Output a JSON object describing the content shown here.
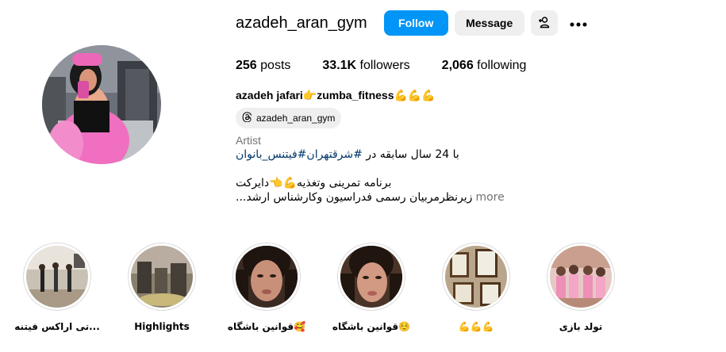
{
  "profile": {
    "username": "azadeh_aran_gym",
    "follow_label": "Follow",
    "message_label": "Message",
    "posts_count": "256",
    "posts_label": " posts",
    "followers_count": "33.1K",
    "followers_label": " followers",
    "following_count": "2,066",
    "following_label": " following",
    "full_name": "azadeh jafari👉zumba_fitness💪💪💪",
    "threads_handle": "azadeh_aran_gym",
    "category": "Artist",
    "bio_line1": "با 24 سال سابقه در ",
    "bio_hashtags": "#شرقتهران#فیتنس_بانوان",
    "bio_line3": "برنامه تمرینی وتغذیه💪👈دایرکت",
    "bio_line4": "زیرنظرمربیان رسمی فدراسیون وکارشناس ارشد...",
    "more_label": "more"
  },
  "highlights": [
    {
      "label": "تی اراکس فیتنه..."
    },
    {
      "label": "Highlights"
    },
    {
      "label": "قوانین باشگاه🥰"
    },
    {
      "label": "قوانین باشگاه☺️"
    },
    {
      "label": "💪💪💪"
    },
    {
      "label": "تولد بازی"
    }
  ],
  "colors": {
    "follow_button": "#0095f6",
    "secondary_button": "#efefef",
    "muted_text": "#737373",
    "hashtag": "#00376b"
  },
  "icons": {
    "add_user": "add-user-icon",
    "more": "more-options-icon",
    "threads": "threads-icon"
  }
}
